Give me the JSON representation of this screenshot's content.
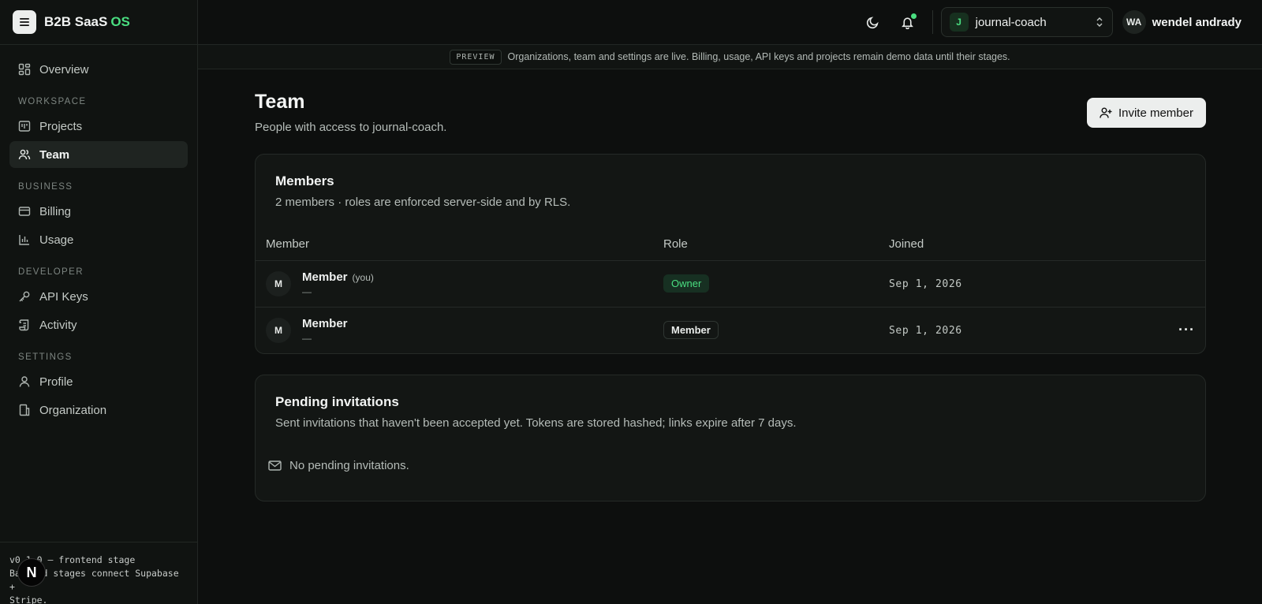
{
  "brand": {
    "name": "B2B SaaS",
    "accent": "OS"
  },
  "sidebar": {
    "overview": "Overview",
    "sections": {
      "workspace": "WORKSPACE",
      "business": "BUSINESS",
      "developer": "DEVELOPER",
      "settings": "SETTINGS"
    },
    "items": {
      "projects": "Projects",
      "team": "Team",
      "billing": "Billing",
      "usage": "Usage",
      "api_keys": "API Keys",
      "activity": "Activity",
      "profile": "Profile",
      "organization": "Organization"
    },
    "footer": {
      "line1": "v0.1.0 — frontend stage",
      "line2": "Backend stages connect Supabase +",
      "line3": "Stripe."
    },
    "n_badge": "N"
  },
  "topbar": {
    "org_initial": "J",
    "org_name": "journal-coach",
    "user_initials": "WA",
    "user_name": "wendel andrady"
  },
  "banner": {
    "tag": "PREVIEW",
    "text": "Organizations, team and settings are live. Billing, usage, API keys and projects remain demo data until their stages."
  },
  "page": {
    "title": "Team",
    "subtitle": "People with access to journal-coach.",
    "invite_label": "Invite member"
  },
  "members_card": {
    "title": "Members",
    "description": "2 members · roles are enforced server-side and by RLS.",
    "columns": {
      "member": "Member",
      "role": "Role",
      "joined": "Joined"
    },
    "rows": [
      {
        "initial": "M",
        "name": "Member",
        "you": "(you)",
        "email": "—",
        "role": "Owner",
        "joined": "Sep 1, 2026"
      },
      {
        "initial": "M",
        "name": "Member",
        "email": "—",
        "role": "Member",
        "joined": "Sep 1, 2026",
        "actions": "···"
      }
    ]
  },
  "invites_card": {
    "title": "Pending invitations",
    "description": "Sent invitations that haven't been accepted yet. Tokens are stored hashed; links expire after 7 days.",
    "empty": "No pending invitations."
  },
  "colors": {
    "accent": "#4ade80",
    "background": "#0d0f0e",
    "card": "#131614"
  }
}
